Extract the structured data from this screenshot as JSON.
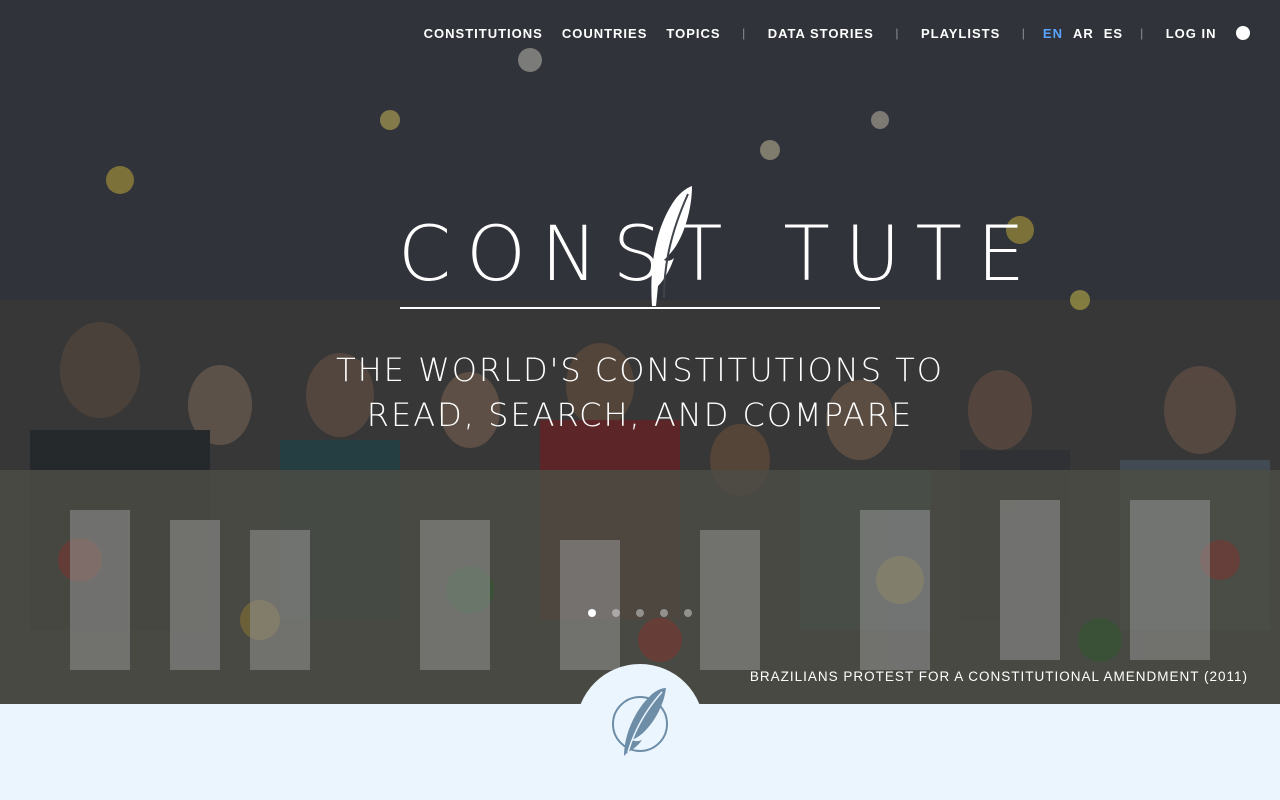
{
  "nav": {
    "links": [
      "CONSTITUTIONS",
      "COUNTRIES",
      "TOPICS"
    ],
    "data_stories": "DATA STORIES",
    "playlists": "PLAYLISTS",
    "separator": "|",
    "languages": [
      "EN",
      "AR",
      "ES"
    ],
    "active_language": "EN",
    "login": "LOG IN",
    "help_icon": "question-circle-icon",
    "help_glyph": "?"
  },
  "logo": {
    "before": "CONST",
    "after": "TUTE",
    "icon": "feather-icon"
  },
  "hero": {
    "tagline_line1": "THE WORLD'S CONSTITUTIONS TO",
    "tagline_line2": "READ, SEARCH, AND COMPARE",
    "caption": "BRAZILIANS PROTEST FOR A CONSTITUTIONAL AMENDMENT (2011)",
    "slides": {
      "count": 5,
      "active": 1
    }
  },
  "badge": {
    "icon": "feather-circle-icon"
  },
  "colors": {
    "accent_language": "#5aa4ff",
    "bottom_band": "#eaf5fe",
    "badge_icon": "#6e8ea8",
    "text_on_hero": "#ffffff"
  }
}
